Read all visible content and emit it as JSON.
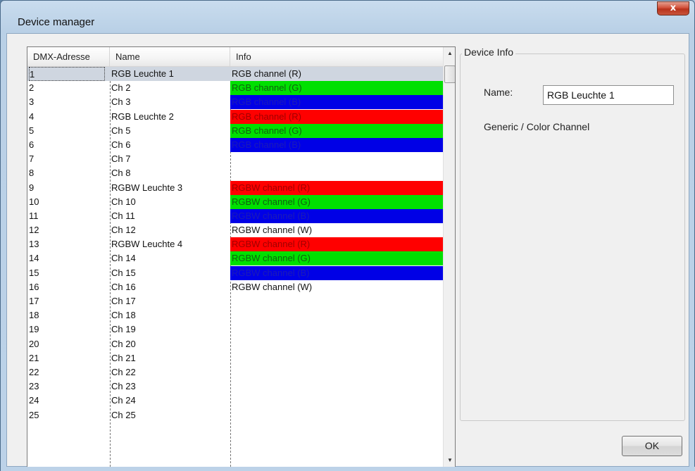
{
  "window": {
    "title": "Device manager",
    "close_label": "x"
  },
  "list": {
    "columns": [
      "DMX-Adresse",
      "Name",
      "Info"
    ],
    "rows": [
      {
        "addr": "1",
        "name": "RGB Leuchte 1",
        "info": "RGB channel (R)",
        "color": "",
        "selected": true
      },
      {
        "addr": "2",
        "name": "Ch 2",
        "info": "RGB channel (G)",
        "color": "green"
      },
      {
        "addr": "3",
        "name": "Ch 3",
        "info": "RGB channel (B)",
        "color": "blue"
      },
      {
        "addr": "4",
        "name": "RGB Leuchte 2",
        "info": "RGB channel (R)",
        "color": "red"
      },
      {
        "addr": "5",
        "name": "Ch 5",
        "info": "RGB channel (G)",
        "color": "green"
      },
      {
        "addr": "6",
        "name": "Ch 6",
        "info": "RGB channel (B)",
        "color": "blue"
      },
      {
        "addr": "7",
        "name": "Ch 7",
        "info": "",
        "color": ""
      },
      {
        "addr": "8",
        "name": "Ch 8",
        "info": "",
        "color": ""
      },
      {
        "addr": "9",
        "name": "RGBW Leuchte 3",
        "info": "RGBW channel (R)",
        "color": "red"
      },
      {
        "addr": "10",
        "name": "Ch 10",
        "info": "RGBW channel (G)",
        "color": "green"
      },
      {
        "addr": "11",
        "name": "Ch 11",
        "info": "RGBW channel (B)",
        "color": "blue"
      },
      {
        "addr": "12",
        "name": "Ch 12",
        "info": "RGBW channel (W)",
        "color": ""
      },
      {
        "addr": "13",
        "name": "RGBW Leuchte 4",
        "info": "RGBW channel (R)",
        "color": "red"
      },
      {
        "addr": "14",
        "name": "Ch 14",
        "info": "RGBW channel (G)",
        "color": "green"
      },
      {
        "addr": "15",
        "name": "Ch 15",
        "info": "RGBW channel (B)",
        "color": "blue"
      },
      {
        "addr": "16",
        "name": "Ch 16",
        "info": "RGBW channel (W)",
        "color": ""
      },
      {
        "addr": "17",
        "name": "Ch 17",
        "info": "",
        "color": ""
      },
      {
        "addr": "18",
        "name": "Ch 18",
        "info": "",
        "color": ""
      },
      {
        "addr": "19",
        "name": "Ch 19",
        "info": "",
        "color": ""
      },
      {
        "addr": "20",
        "name": "Ch 20",
        "info": "",
        "color": ""
      },
      {
        "addr": "21",
        "name": "Ch 21",
        "info": "",
        "color": ""
      },
      {
        "addr": "22",
        "name": "Ch 22",
        "info": "",
        "color": ""
      },
      {
        "addr": "23",
        "name": "Ch 23",
        "info": "",
        "color": ""
      },
      {
        "addr": "24",
        "name": "Ch 24",
        "info": "",
        "color": ""
      },
      {
        "addr": "25",
        "name": "Ch 25",
        "info": "",
        "color": ""
      }
    ]
  },
  "device_info": {
    "group_title": "Device Info",
    "name_label": "Name:",
    "name_value": "RGB Leuchte 1",
    "type_text": "Generic / Color Channel"
  },
  "buttons": {
    "ok_label": "OK"
  },
  "colors": {
    "red": "#ff0000",
    "green": "#00e000",
    "blue": "#0000e6",
    "selected": "#cfd6e0"
  }
}
